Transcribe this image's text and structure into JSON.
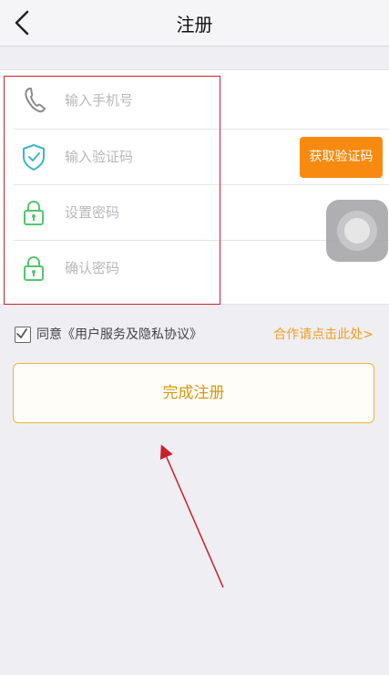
{
  "header": {
    "title": "注册",
    "back_icon": "chevron-left-icon"
  },
  "form": {
    "phone": {
      "placeholder": "输入手机号",
      "value": "",
      "icon": "phone-icon",
      "icon_color": "#8a8a8f"
    },
    "code": {
      "placeholder": "输入验证码",
      "value": "",
      "icon": "shield-check-icon",
      "icon_color": "#3fb6c6"
    },
    "password": {
      "placeholder": "设置密码",
      "value": "",
      "icon": "lock-icon",
      "icon_color": "#55c56e"
    },
    "confirm": {
      "placeholder": "确认密码",
      "value": "",
      "icon": "lock-icon",
      "icon_color": "#55c56e"
    },
    "get_code_label": "获取验证码"
  },
  "agreement": {
    "checked": true,
    "text": "同意《用户服务及隐私协议》"
  },
  "cooperation_link": "合作请点击此处>",
  "submit_label": "完成注册",
  "colors": {
    "accent_orange": "#f98a10",
    "link_orange": "#f0a020",
    "highlight_red": "#c8202e",
    "submit_border": "#f2b632"
  }
}
